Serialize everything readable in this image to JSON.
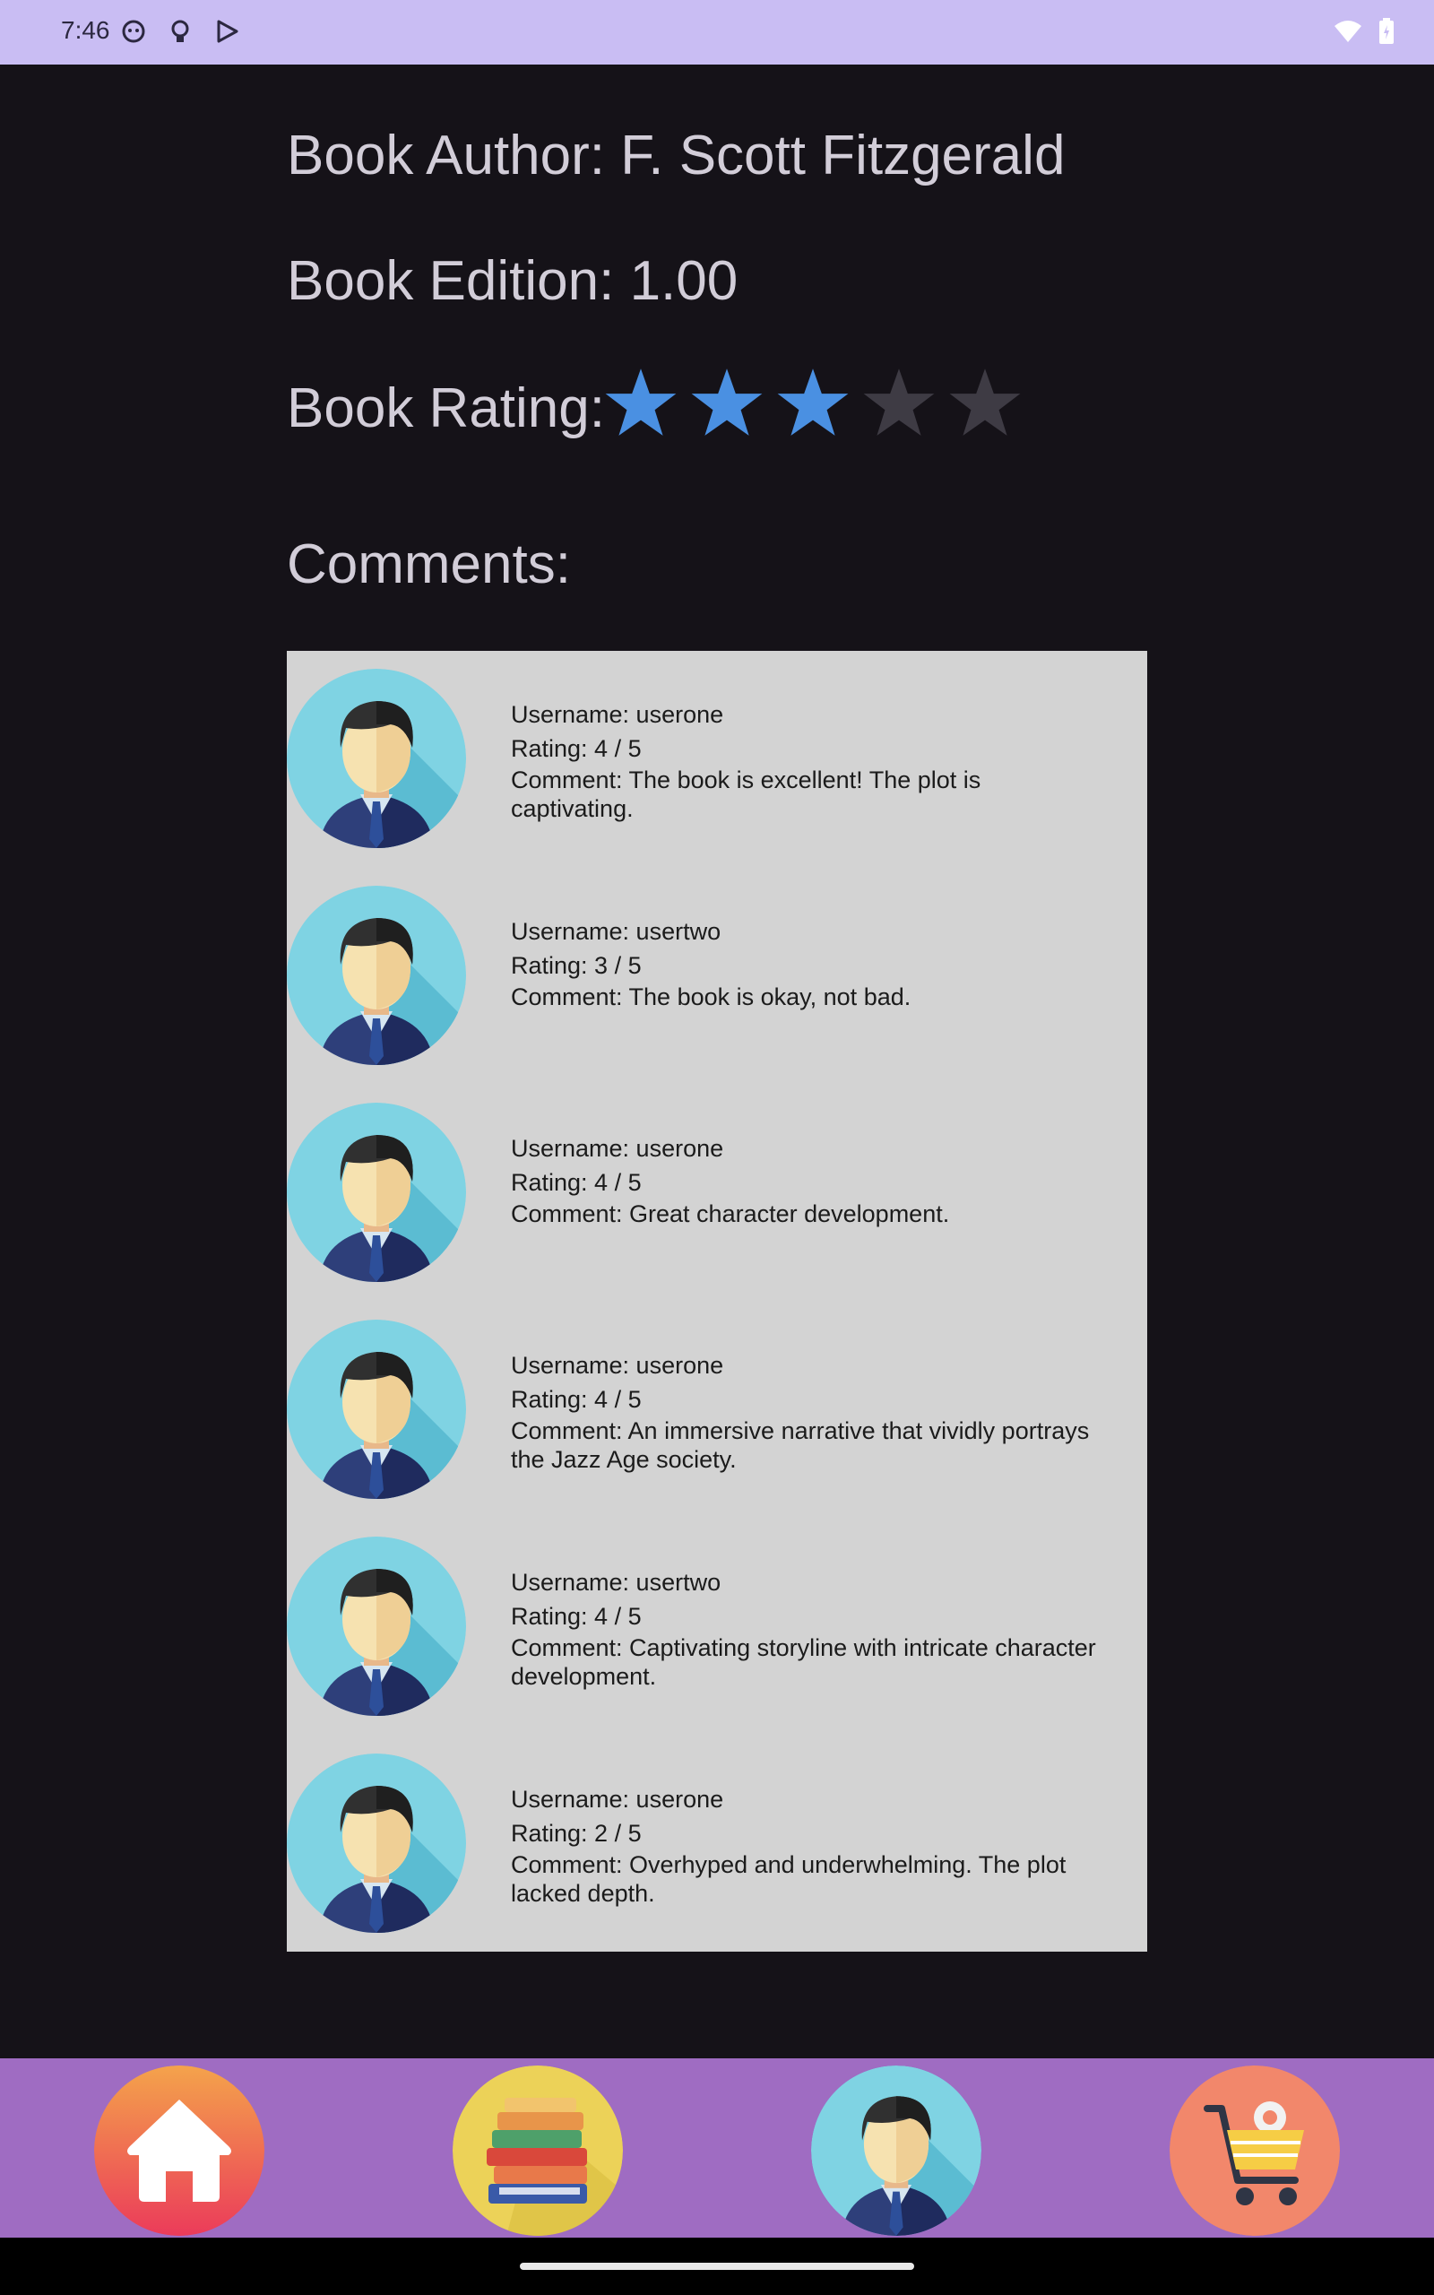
{
  "status_bar": {
    "time": "7:46",
    "left_icons": [
      "face-notification-icon",
      "lightbulb-icon",
      "play-store-icon"
    ],
    "right_icons": [
      "wifi-icon",
      "battery-icon"
    ]
  },
  "book": {
    "author_line": "Book Author: F. Scott Fitzgerald",
    "edition_line": "Book Edition: 1.00",
    "rating_label": "Book Rating:",
    "rating_value": 3,
    "rating_max": 5,
    "comments_heading": "Comments:"
  },
  "colors": {
    "star_filled": "#4a90e2",
    "star_empty": "#3e3b44",
    "comments_bg": "#d3d3d3",
    "nav_bg": "#9f6cc2",
    "status_bg": "#c9bdf3"
  },
  "comments": [
    {
      "username": "Username: userone",
      "rating": "Rating: 4 / 5",
      "comment": "Comment: The book is excellent! The plot is captivating."
    },
    {
      "username": "Username: usertwo",
      "rating": "Rating: 3 / 5",
      "comment": "Comment: The book is okay, not bad."
    },
    {
      "username": "Username: userone",
      "rating": "Rating: 4 / 5",
      "comment": "Comment: Great character development."
    },
    {
      "username": "Username: userone",
      "rating": "Rating: 4 / 5",
      "comment": "Comment: An immersive narrative that vividly portrays the Jazz Age society."
    },
    {
      "username": "Username: usertwo",
      "rating": "Rating: 4 / 5",
      "comment": "Comment: Captivating storyline with intricate character development."
    },
    {
      "username": "Username: userone",
      "rating": "Rating: 2 / 5",
      "comment": "Comment: Overhyped and underwhelming. The plot lacked depth."
    }
  ],
  "bottom_nav": {
    "items": [
      {
        "icon": "home-icon"
      },
      {
        "icon": "books-icon"
      },
      {
        "icon": "profile-avatar-icon"
      },
      {
        "icon": "shopping-cart-icon"
      }
    ]
  }
}
